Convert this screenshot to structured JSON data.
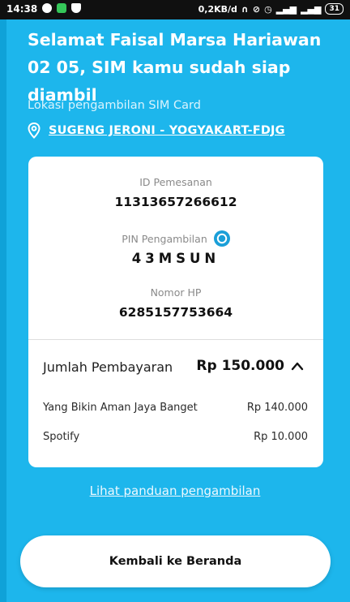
{
  "status_bar": {
    "time": "14:38",
    "network_speed": "0,2KB/d",
    "battery": "31"
  },
  "header": {
    "title": "Selamat Faisal Marsa Hariawan 02 05, SIM kamu sudah siap diambil",
    "location_label": "Lokasi pengambilan SIM Card",
    "location_value": "SUGENG JERONI - YOGYAKART-FDJG"
  },
  "card": {
    "order_id_label": "ID Pemesanan",
    "order_id_value": "11313657266612",
    "pin_label": "PIN Pengambilan",
    "pin_value": "43MSUN",
    "phone_label": "Nomor HP",
    "phone_value": "6285157753664",
    "payment_label": "Jumlah Pembayaran",
    "payment_total": "Rp 150.000",
    "items": [
      {
        "name": "Yang Bikin Aman Jaya Banget",
        "price": "Rp 140.000"
      },
      {
        "name": "Spotify",
        "price": "Rp 10.000"
      }
    ]
  },
  "guide_link": "Lihat panduan pengambilan",
  "home_button": "Kembali ke Beranda",
  "colors": {
    "background": "#1db6ec",
    "card": "#ffffff",
    "status_bar": "#101010"
  }
}
